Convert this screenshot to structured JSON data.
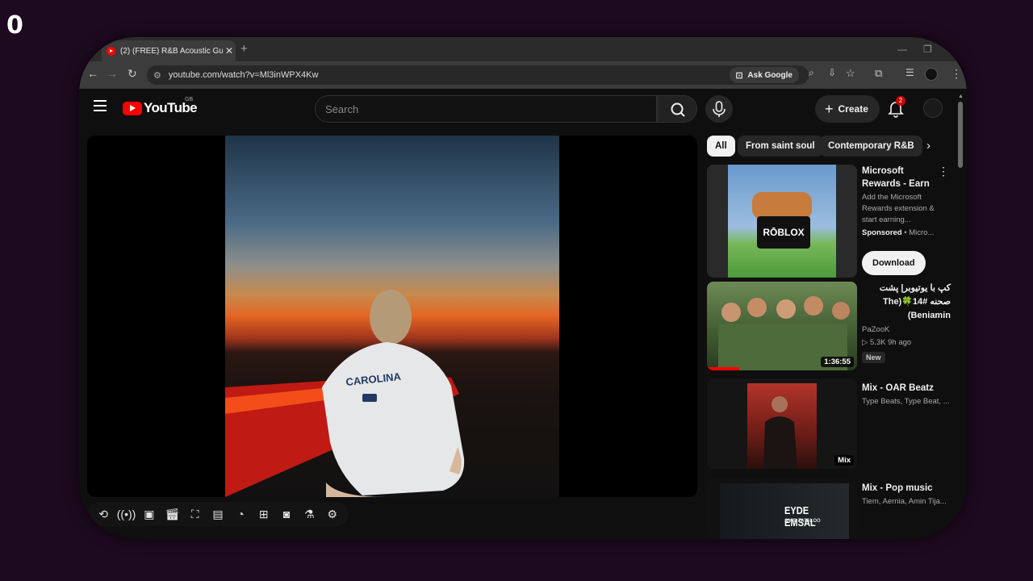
{
  "overlay": {
    "counter": "0"
  },
  "browser": {
    "tab_title": "(2) (FREE) R&B Acoustic Guitar",
    "url": "youtube.com/watch?v=Ml3inWPX4Kw",
    "ask_google_label": "Ask Google"
  },
  "yt": {
    "logo_text": "YouTube",
    "region": "GB",
    "search_placeholder": "Search",
    "create_label": "Create",
    "notification_count": "2"
  },
  "chips": [
    "All",
    "From saint soul",
    "Contemporary R&B"
  ],
  "sidebar": {
    "ad": {
      "title_line1": "Microsoft",
      "title_line2": "Rewards - Earn",
      "desc": "Add the Microsoft Rewards extension & start earning...",
      "sponsored": "Sponsored",
      "advertiser": "• Micro...",
      "cta": "Download",
      "thumb_text": "RŌBLOX"
    },
    "videos": [
      {
        "title": "کپ با یوتیوبر| پشت صحنه The)🍀14# (Beniamin",
        "channel": "PaZooK",
        "stats": "▷ 5.3K  9h ago",
        "badge": "New",
        "duration": "1:36:55"
      },
      {
        "title": "Mix - OAR Beatz",
        "channel": "Type Beats, Type Beat, ...",
        "duration": "Mix"
      },
      {
        "title": "Mix - Pop music",
        "channel": "Tiem, Aernia, Amin Tija...",
        "thumb_title": "EYDE EMSAL",
        "thumb_sub": "AMIR TATALOO"
      }
    ]
  },
  "colors": {
    "accent_red": "#ff0000",
    "background": "#1d0a1f"
  }
}
